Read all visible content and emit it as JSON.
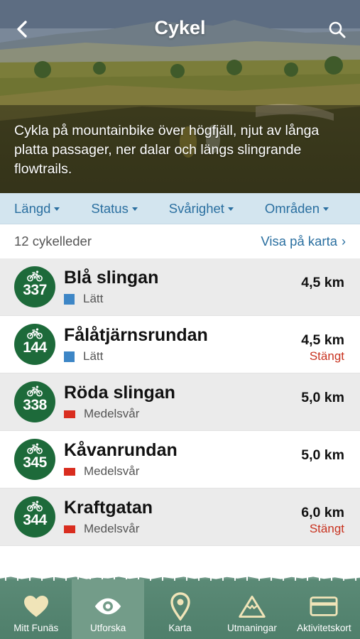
{
  "header": {
    "title": "Cykel",
    "back_icon": "chevron-left-icon",
    "search_icon": "search-icon",
    "description": "Cykla på mountainbike över högfjäll, njut av långa platta passager, ner dalar och längs slingrande flowtrails."
  },
  "filters": [
    {
      "label": "Längd"
    },
    {
      "label": "Status"
    },
    {
      "label": "Svårighet"
    },
    {
      "label": "Områden"
    }
  ],
  "summary": {
    "count_text": "12 cykelleder",
    "map_link": "Visa på karta",
    "map_chevron": "›"
  },
  "trails": [
    {
      "number": "337",
      "name": "Blå slingan",
      "difficulty": "Lätt",
      "difficulty_level": "easy",
      "distance": "4,5 km",
      "status": ""
    },
    {
      "number": "144",
      "name": "Fålåtjärnsrundan",
      "difficulty": "Lätt",
      "difficulty_level": "easy",
      "distance": "4,5 km",
      "status": "Stängt"
    },
    {
      "number": "338",
      "name": "Röda slingan",
      "difficulty": "Medelsvår",
      "difficulty_level": "medium",
      "distance": "5,0 km",
      "status": ""
    },
    {
      "number": "345",
      "name": "Kåvanrundan",
      "difficulty": "Medelsvår",
      "difficulty_level": "medium",
      "distance": "5,0 km",
      "status": ""
    },
    {
      "number": "344",
      "name": "Kraftgatan",
      "difficulty": "Medelsvår",
      "difficulty_level": "medium",
      "distance": "6,0 km",
      "status": "Stängt"
    }
  ],
  "tabs": [
    {
      "label": "Mitt Funäs",
      "icon": "heart-icon",
      "active": false
    },
    {
      "label": "Utforska",
      "icon": "eye-icon",
      "active": true
    },
    {
      "label": "Karta",
      "icon": "map-pin-icon",
      "active": false
    },
    {
      "label": "Utmaningar",
      "icon": "mountain-icon",
      "active": false
    },
    {
      "label": "Aktivitetskort",
      "icon": "card-icon",
      "active": false
    }
  ],
  "colors": {
    "accent_blue": "#2a6fa0",
    "filter_bar": "#d3e5ef",
    "badge_green": "#1d6a3a",
    "easy_blue": "#3d86c6",
    "medium_red": "#d92d1f",
    "closed_red": "#c8321f",
    "tab_bar": "#5b8a76",
    "tab_active": "#739c89",
    "tab_icon": "#f0e4b8"
  }
}
